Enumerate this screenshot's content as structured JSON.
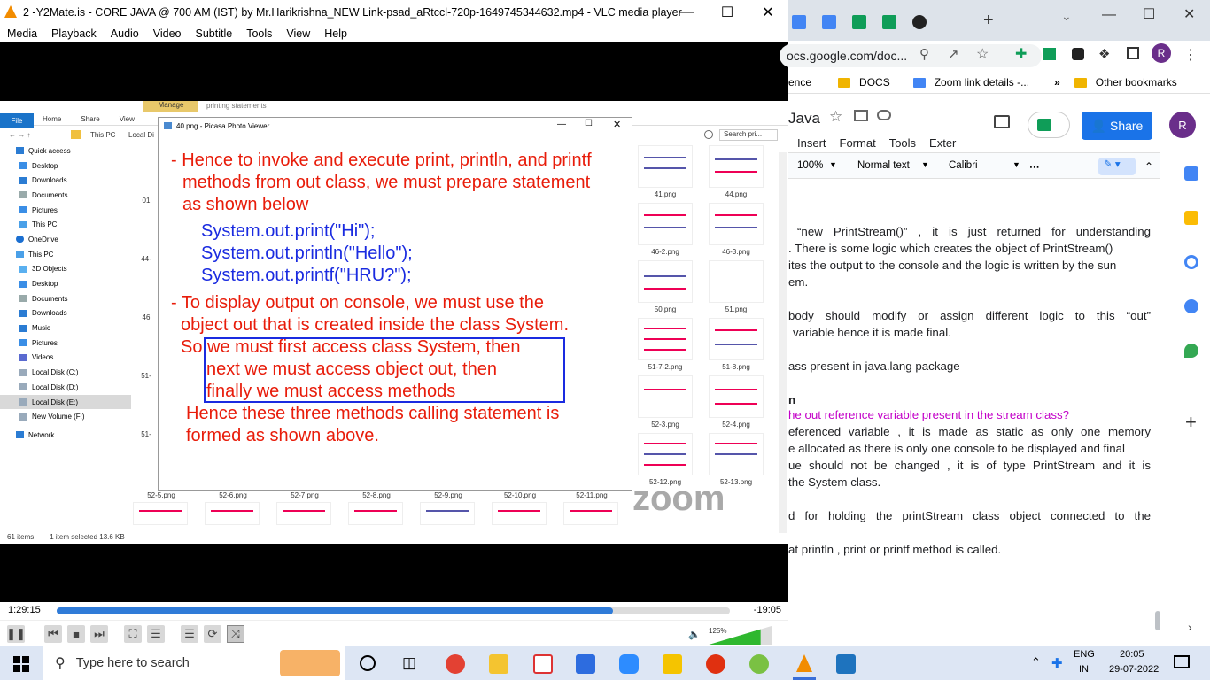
{
  "vlc": {
    "title": "2 -Y2Mate.is - CORE JAVA @ 700 AM (IST) by Mr.Harikrishna_NEW Link-psad_aRtccl-720p-1649745344632.mp4 - VLC media player",
    "menu": [
      "Media",
      "Playback",
      "Audio",
      "Video",
      "Subtitle",
      "Tools",
      "View",
      "Help"
    ],
    "elapsed": "1:29:15",
    "remaining": "-19:05",
    "progress": 0.826,
    "volume_label": "125%",
    "volume": 1.25
  },
  "explorer": {
    "manage_tab": "Manage",
    "context_title": "printing statements",
    "ribbon_tabs": [
      "File",
      "Home",
      "Share",
      "View"
    ],
    "address": [
      "This PC",
      "Local Di"
    ],
    "search_placeholder": "Search pri...",
    "nav": [
      "Quick access",
      "Desktop",
      "Downloads",
      "Documents",
      "Pictures",
      "This PC",
      "OneDrive",
      "This PC",
      "3D Objects",
      "Desktop",
      "Documents",
      "Downloads",
      "Music",
      "Pictures",
      "Videos",
      "Local Disk (C:)",
      "Local Disk (D:)",
      "Local Disk (E:)",
      "New Volume (F:)",
      "Network"
    ],
    "right_thumbs": [
      "41.png",
      "44.png",
      "46-2.png",
      "46-3.png",
      "50.png",
      "51.png",
      "51-7-2.png",
      "51-8.png",
      "52-3.png",
      "52-4.png",
      "52-12.png",
      "52-13.png"
    ],
    "left_labels": [
      "01",
      "44-",
      "46",
      "51-",
      "51-"
    ],
    "bottom_labels": [
      "52-5.png",
      "52-6.png",
      "52-7.png",
      "52-8.png",
      "52-9.png",
      "52-10.png",
      "52-11.png"
    ],
    "status_items": "61 items",
    "status_selected": "1 item selected  13.6 KB"
  },
  "picasa": {
    "title": "40.png - Picasa Photo Viewer",
    "lines": [
      "- Hence to invoke and execute print, println, and printf",
      "methods from out class, we must prepare statement",
      "as shown below",
      "System.out.print(\"Hi\");",
      "System.out.println(\"Hello\");",
      "System.out.printf(\"HRU?\");",
      "- To display output on console, we must use the",
      "object out that is created inside the class System.",
      "So we must first access class System, then",
      "next we must access object out, then",
      "finally we must access methods",
      "Hence these three methods calling statement is",
      "formed as shown above."
    ]
  },
  "watermark": "zoom",
  "chrome": {
    "url": "ocs.google.com/doc...",
    "bookmarks": [
      "ence",
      "DOCS",
      "Zoom link details -...",
      "Other bookmarks"
    ],
    "profile": "R"
  },
  "gdoc": {
    "title": "Java",
    "menu": [
      "Insert",
      "Format",
      "Tools",
      "Exter"
    ],
    "share": "Share",
    "zoom": "100%",
    "style": "Normal text",
    "font": "Calibri",
    "lines": [
      "“new PrintStream()” , it is just returned for understanding",
      ". There is some logic which creates the object of PrintStream()",
      "ites the output to the console and the logic is written by the sun",
      "em.",
      "body should modify or assign different logic to this “out”",
      "variable  hence it is made final.",
      "ass present in java.lang package",
      "n",
      "he out reference variable present in the stream class?",
      "eferenced variable ,  it is made as static as only one memory",
      "e allocated as there is only one console to be displayed and final",
      "ue should not be changed , it is of type PrintStream and it is",
      "the System class.",
      "d for holding the printStream class object connected to the",
      "at println , print or printf method is called."
    ]
  },
  "taskbar": {
    "search_placeholder": "Type here to search",
    "lang": "ENG",
    "region": "IN",
    "time": "20:05",
    "date": "29-07-2022"
  }
}
